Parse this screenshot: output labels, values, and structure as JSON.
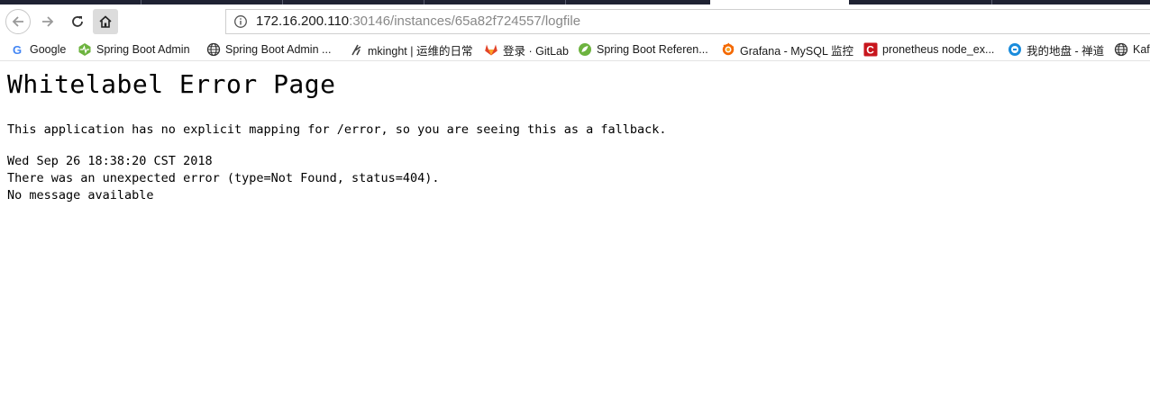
{
  "browser": {
    "url": {
      "host": "172.16.200.110",
      "rest": ":30146/instances/65a82f724557/logfile"
    },
    "bookmarks": [
      {
        "label": "Google",
        "icon": "google-icon"
      },
      {
        "label": "Spring Boot Admin",
        "icon": "spring-boot-admin-icon"
      },
      {
        "label": "Spring Boot Admin ...",
        "icon": "globe-icon"
      },
      {
        "label": "mkinght | 运维的日常",
        "icon": "site-icon"
      },
      {
        "label": "登录 · GitLab",
        "icon": "gitlab-icon"
      },
      {
        "label": "Spring Boot Referen...",
        "icon": "spring-icon"
      },
      {
        "label": "Grafana - MySQL 监控",
        "icon": "grafana-icon"
      },
      {
        "label": "pronetheus node_ex...",
        "icon": "csdn-icon"
      },
      {
        "label": "我的地盘 - 禅道",
        "icon": "zentao-icon"
      },
      {
        "label": "Kaf",
        "icon": "globe-icon"
      }
    ]
  },
  "page": {
    "title": "Whitelabel Error Page",
    "message": "This application has no explicit mapping for /error, so you are seeing this as a fallback.",
    "timestamp": "Wed Sep 26 18:38:20 CST 2018",
    "error": "There was an unexpected error (type=Not Found, status=404).",
    "detail": "No message available"
  }
}
